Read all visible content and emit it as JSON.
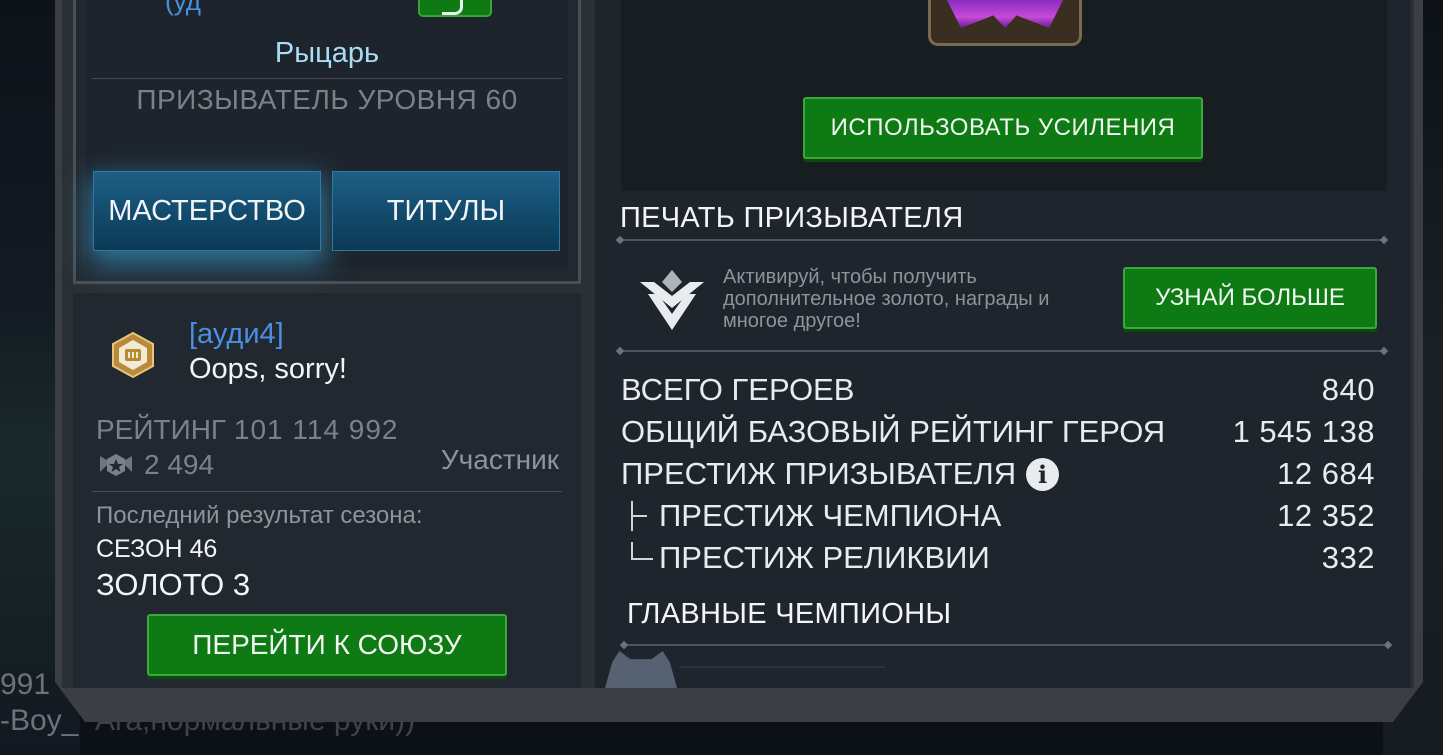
{
  "background": {
    "chat_lines": [
      {
        "text": "991"
      },
      {
        "text": "-Boy_",
        "faded_text": "Ага,нормальные руки))"
      }
    ]
  },
  "profile": {
    "top_name_fragment": "(уд",
    "class_title": "Рыцарь",
    "summoner_level": "ПРИЗЫВАТЕЛЬ УРОВНЯ 60",
    "buttons": {
      "mastery": "МАСТЕРСТВО",
      "titles": "ТИТУЛЫ"
    }
  },
  "alliance": {
    "tag": "[ауди4]",
    "message": "Oops, sorry!",
    "rating_label": "РЕЙТИНГ",
    "rating_value": "101 114 992",
    "score": "2 494",
    "role": "Участник",
    "last_season_label": "Последний результат сезона:",
    "season": "СЕЗОН 46",
    "rank": "ЗОЛОТО 3",
    "go_button": "ПЕРЕЙТИ К СОЮЗУ"
  },
  "boost": {
    "use_button": "ИСПОЛЬЗОВАТЬ УСИЛЕНИЯ"
  },
  "seal": {
    "title": "ПЕЧАТЬ ПРИЗЫВАТЕЛЯ",
    "description": "Активируй, чтобы получить дополнительное золото, награды и многое другое!",
    "learn_button": "УЗНАЙ БОЛЬШЕ"
  },
  "stats": {
    "total_heroes": {
      "label": "ВСЕГО ГЕРОЕВ",
      "value": "840"
    },
    "base_rating": {
      "label": "ОБЩИЙ БАЗОВЫЙ РЕЙТИНГ ГЕРОЯ",
      "value": "1 545 138"
    },
    "summoner_prestige": {
      "label": "ПРЕСТИЖ ПРИЗЫВАТЕЛЯ",
      "value": "12 684"
    },
    "champion_prestige": {
      "label": "ПРЕСТИЖ ЧЕМПИОНА",
      "value": "12 352"
    },
    "relic_prestige": {
      "label": "ПРЕСТИЖ РЕЛИКВИИ",
      "value": "332"
    }
  },
  "top_champions": {
    "title": "ГЛАВНЫЕ ЧЕМПИОНЫ"
  },
  "colors": {
    "accent_green": "#0e7a13",
    "accent_blue": "#124a6b",
    "link_blue": "#4a8fe0",
    "knight_text": "#a9dcf5"
  }
}
